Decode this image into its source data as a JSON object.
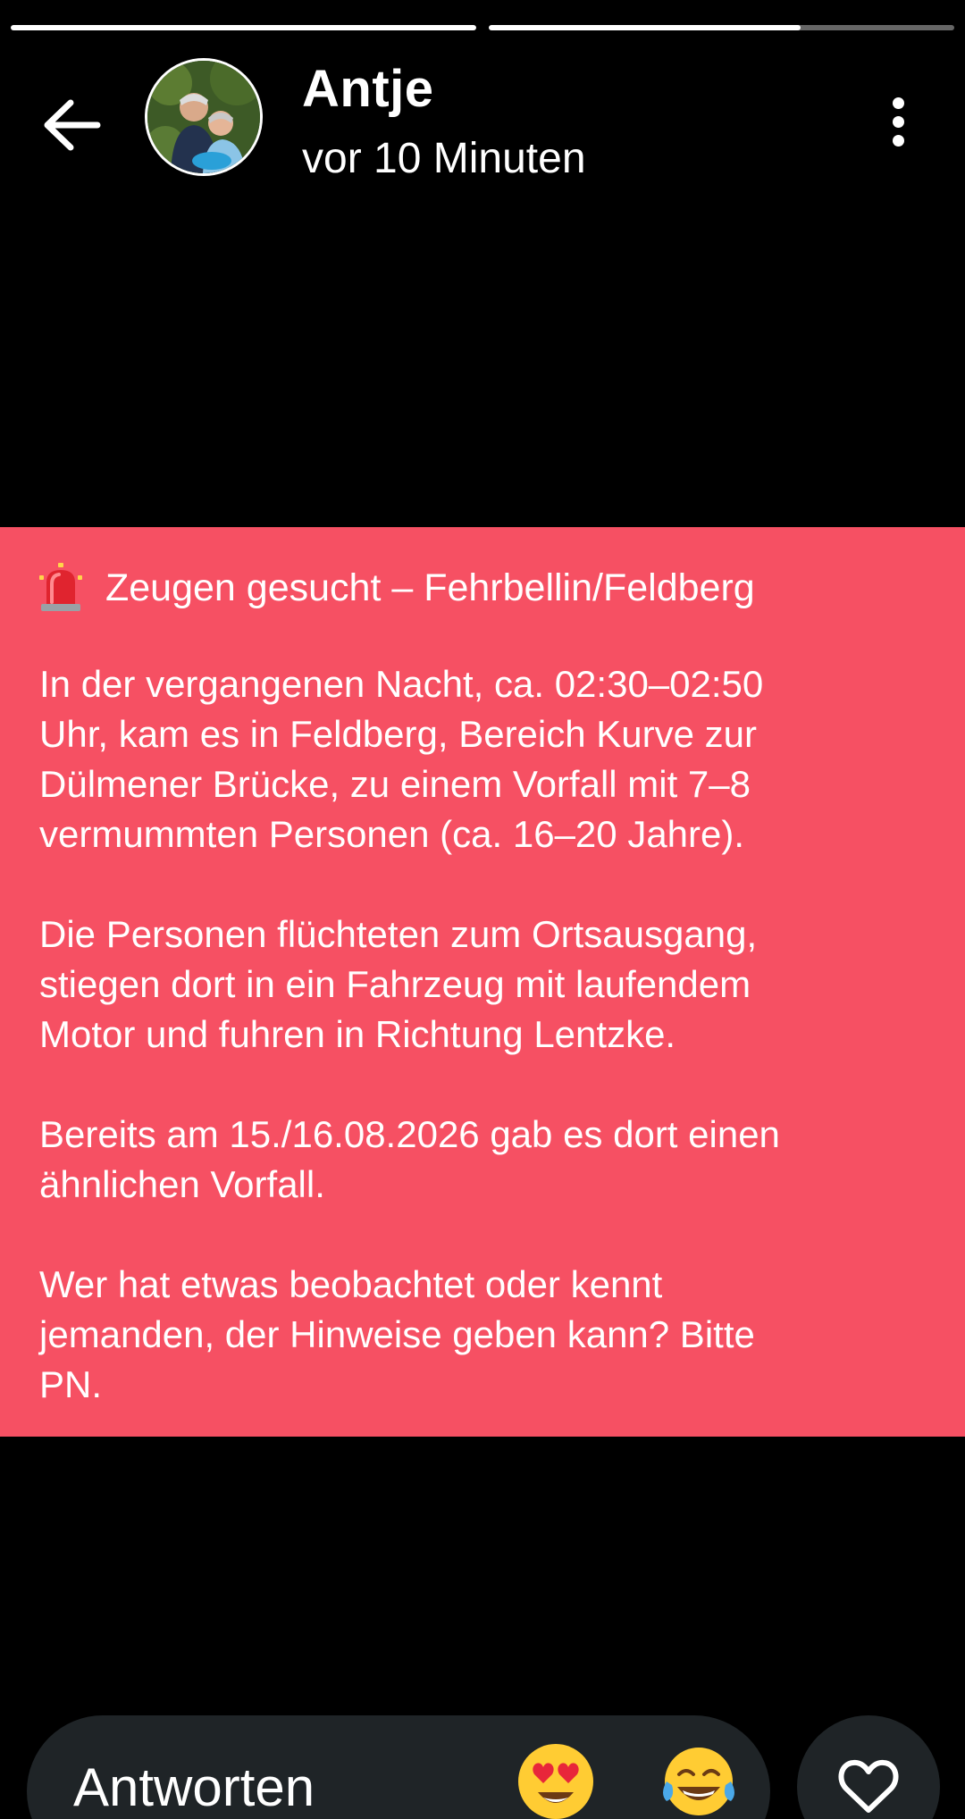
{
  "progress": {
    "segments": [
      {
        "fill": 1.0
      },
      {
        "fill": 0.67
      }
    ]
  },
  "header": {
    "username": "Antje",
    "timestamp": "vor 10 Minuten",
    "back_icon": "arrow-left-icon",
    "more_icon": "more-vertical-icon"
  },
  "story": {
    "background_color": "#f65063",
    "title": "Zeugen gesucht – Fehrbellin/Feldberg",
    "title_icon": "siren-icon",
    "paragraphs": [
      "In der vergangenen Nacht, ca. 02:30–02:50\nUhr, kam es in Feldberg, Bereich Kurve zur\nDülmener Brücke, zu einem Vorfall mit 7–8\nvermummten Personen (ca. 16–20 Jahre).",
      "Die Personen flüchteten zum Ortsausgang,\nstiegen dort in ein Fahrzeug mit laufendem\nMotor und fuhren in Richtung Lentzke.",
      "Bereits am 15./16.08.2026 gab es dort einen\nähnlichen Vorfall.",
      "Wer hat etwas beobachtet oder kennt\njemanden, der Hinweise geben kann? Bitte\nPN."
    ]
  },
  "reply": {
    "placeholder": "Antworten",
    "emoji_1": "heart-eyes-emoji-icon",
    "emoji_2": "tears-of-joy-emoji-icon",
    "like_icon": "heart-icon"
  }
}
